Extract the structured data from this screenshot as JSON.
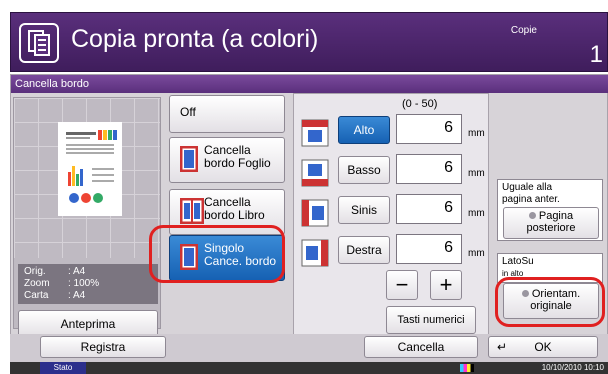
{
  "header": {
    "title": "Copia pronta (a colori)",
    "copies_label": "Copie",
    "copies_count": "1"
  },
  "screen_title": "Cancella bordo",
  "preview": {
    "orig_label": "Orig.",
    "orig_value": ": A4",
    "zoom_label": "Zoom",
    "zoom_value": ": 100%",
    "paper_label": "Carta",
    "paper_value": ": A4",
    "button": "Anteprima"
  },
  "modes": [
    {
      "label": "Off"
    },
    {
      "label1": "Cancella",
      "label2": "bordo Foglio"
    },
    {
      "label1": "Cancella",
      "label2": "bordo Libro"
    },
    {
      "label1": "Singolo",
      "label2": "Cance. bordo"
    }
  ],
  "edges": {
    "range": "(0 - 50)",
    "unit": "mm",
    "rows": [
      {
        "label": "Alto",
        "value": "6"
      },
      {
        "label": "Basso",
        "value": "6"
      },
      {
        "label": "Sinis",
        "value": "6"
      },
      {
        "label": "Destra",
        "value": "6"
      }
    ],
    "minus": "−",
    "plus": "+",
    "numpad": "Tasti numerici"
  },
  "right": {
    "same_page_line1": "Uguale alla",
    "same_page_line2": "pagina anter.",
    "back_page_line1": "Pagina",
    "back_page_line2": "posteriore",
    "orient_line1": "LatoSu",
    "orient_line2": "in alto",
    "orig_orient_line1": "Orientam.",
    "orig_orient_line2": "originale"
  },
  "footer": {
    "register": "Registra",
    "cancel": "Cancella",
    "ok": "OK"
  },
  "status": {
    "tag": "Stato",
    "datetime": "10/10/2010  10:10"
  },
  "colors": {
    "header": "#4a2468",
    "accent_blue": "#1661b3",
    "highlight": "#e02020"
  }
}
